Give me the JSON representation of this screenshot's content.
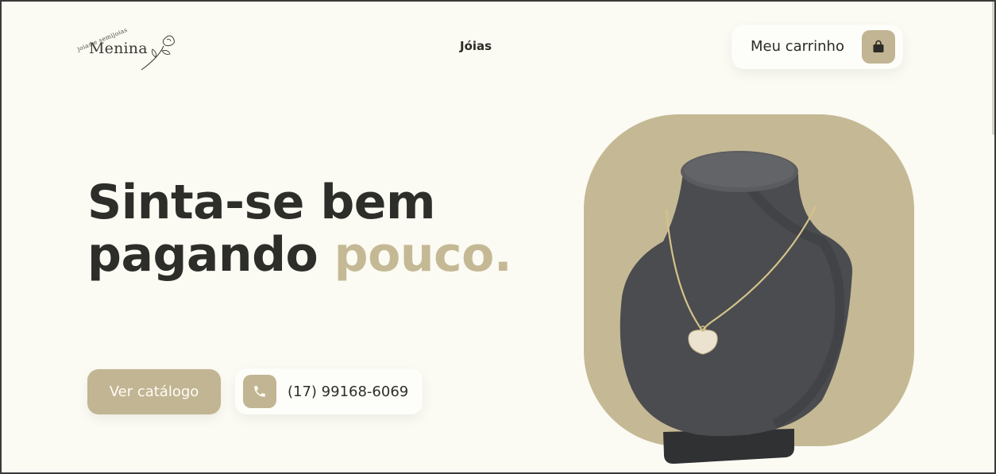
{
  "header": {
    "logo": {
      "brand": "Menina",
      "tagline": "joias e semijoias",
      "icon": "flower-icon"
    },
    "nav": {
      "joias": "Jóias"
    },
    "cart": {
      "label": "Meu carrinho",
      "icon": "shopping-bag-icon"
    }
  },
  "hero": {
    "title_line1": "Sinta-se bem",
    "title_line2": "pagando",
    "title_accent": "pouco.",
    "catalog_button": "Ver catálogo",
    "phone": {
      "number": "(17) 99168-6069",
      "icon": "phone-icon"
    },
    "image": {
      "subject": "necklace-on-bust"
    }
  },
  "colors": {
    "background": "#fbfaf3",
    "accent": "#c2b593",
    "text": "#2d2d29"
  }
}
